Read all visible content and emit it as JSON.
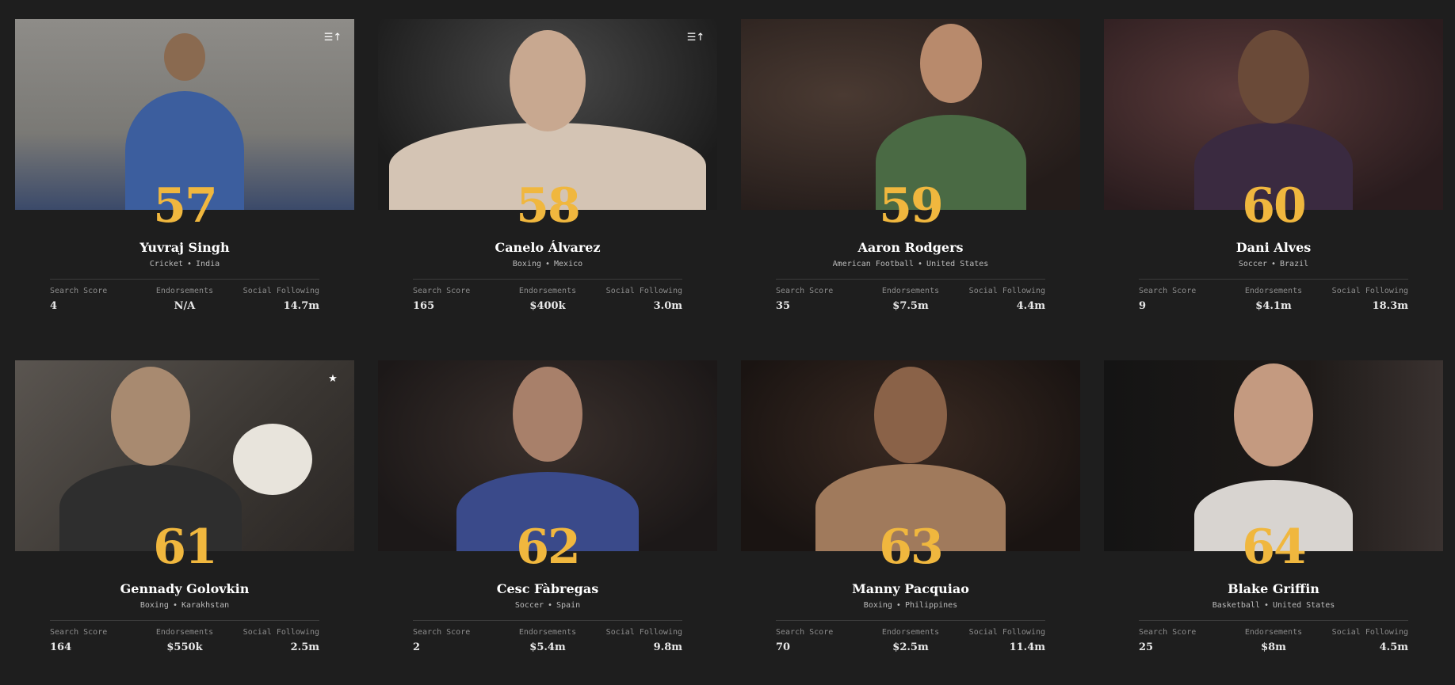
{
  "athletes": [
    {
      "rank": "57",
      "name": "Yuvraj Singh",
      "sport": "Cricket",
      "country": "India",
      "search_label": "Search Score",
      "search": "4",
      "endorse_label": "Endorsements",
      "endorse": "N/A",
      "social_label": "Social Following",
      "social": "14.7m",
      "corner_icon": "ranking-up-icon",
      "corner_glyph": "☰↑"
    },
    {
      "rank": "58",
      "name": "Canelo Álvarez",
      "sport": "Boxing",
      "country": "Mexico",
      "search_label": "Search Score",
      "search": "165",
      "endorse_label": "Endorsements",
      "endorse": "$400k",
      "social_label": "Social Following",
      "social": "3.0m",
      "corner_icon": "ranking-up-icon",
      "corner_glyph": "☰↑"
    },
    {
      "rank": "59",
      "name": "Aaron Rodgers",
      "sport": "American Football",
      "country": "United States",
      "search_label": "Search Score",
      "search": "35",
      "endorse_label": "Endorsements",
      "endorse": "$7.5m",
      "social_label": "Social Following",
      "social": "4.4m"
    },
    {
      "rank": "60",
      "name": "Dani Alves",
      "sport": "Soccer",
      "country": "Brazil",
      "search_label": "Search Score",
      "search": "9",
      "endorse_label": "Endorsements",
      "endorse": "$4.1m",
      "social_label": "Social Following",
      "social": "18.3m"
    },
    {
      "rank": "61",
      "name": "Gennady Golovkin",
      "sport": "Boxing",
      "country": "Karakhstan",
      "search_label": "Search Score",
      "search": "164",
      "endorse_label": "Endorsements",
      "endorse": "$550k",
      "social_label": "Social Following",
      "social": "2.5m",
      "corner_icon": "star-icon",
      "corner_glyph": "★"
    },
    {
      "rank": "62",
      "name": "Cesc Fàbregas",
      "sport": "Soccer",
      "country": "Spain",
      "search_label": "Search Score",
      "search": "2",
      "endorse_label": "Endorsements",
      "endorse": "$5.4m",
      "social_label": "Social Following",
      "social": "9.8m"
    },
    {
      "rank": "63",
      "name": "Manny Pacquiao",
      "sport": "Boxing",
      "country": "Philippines",
      "search_label": "Search Score",
      "search": "70",
      "endorse_label": "Endorsements",
      "endorse": "$2.5m",
      "social_label": "Social Following",
      "social": "11.4m"
    },
    {
      "rank": "64",
      "name": "Blake Griffin",
      "sport": "Basketball",
      "country": "United States",
      "search_label": "Search Score",
      "search": "25",
      "endorse_label": "Endorsements",
      "endorse": "$8m",
      "social_label": "Social Following",
      "social": "4.5m"
    }
  ],
  "separator": "•",
  "colors": {
    "background": "#1e1e1e",
    "rank": "#f0b73e",
    "text": "#ffffff",
    "muted": "#8c8c8c",
    "rule": "#3c3c3c"
  }
}
